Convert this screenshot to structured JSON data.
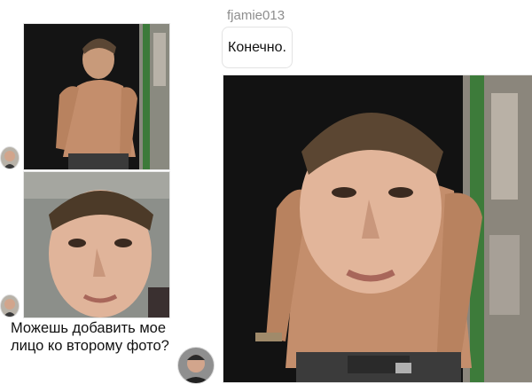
{
  "chat": {
    "username": "fjamie013",
    "reply_text": "Конечно.",
    "question_text": "Можешь добавить мое лицо ко второму фото?"
  },
  "images": {
    "shirtless_photo": "shirtless-man-photo",
    "face_photo": "face-selfie-photo",
    "edited_photo": "face-swapped-edited-photo"
  },
  "colors": {
    "username": "#8e8e8e",
    "bubble_border": "#e3e3e3",
    "text": "#111111"
  }
}
